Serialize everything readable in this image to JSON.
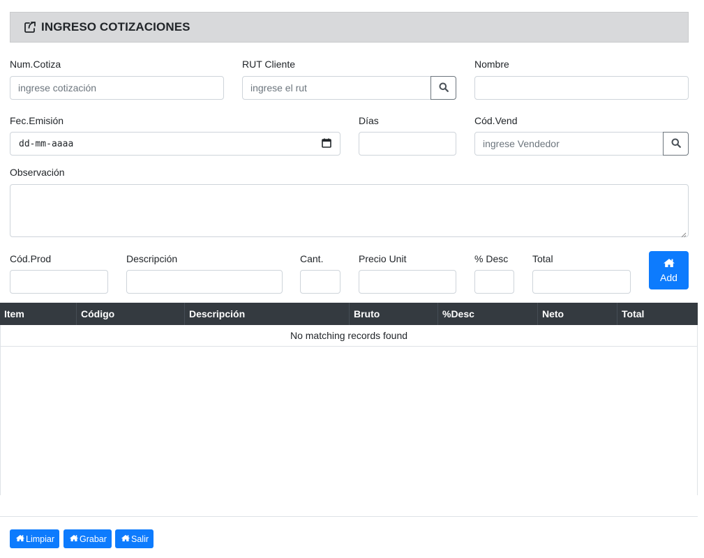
{
  "header": {
    "title": "INGRESO COTIZACIONES",
    "icon": "share-square-icon"
  },
  "form": {
    "num_cotiza": {
      "label": "Num.Cotiza",
      "placeholder": "ingrese cotización",
      "value": ""
    },
    "rut_cliente": {
      "label": "RUT Cliente",
      "placeholder": "ingrese el rut",
      "value": ""
    },
    "nombre": {
      "label": "Nombre",
      "placeholder": "",
      "value": ""
    },
    "fec_emision": {
      "label": "Fec.Emisión",
      "placeholder": "dd-mm-aaaa"
    },
    "dias": {
      "label": "Días",
      "value": ""
    },
    "cod_vend": {
      "label": "Cód.Vend",
      "placeholder": "ingrese Vendedor",
      "value": ""
    },
    "observacion": {
      "label": "Observación",
      "value": ""
    }
  },
  "product_line": {
    "cod_prod_label": "Cód.Prod",
    "descripcion_label": "Descripción",
    "cant_label": "Cant.",
    "precio_unit_label": "Precio Unit",
    "desc_label": "% Desc",
    "total_label": "Total",
    "add_button_label": "Add"
  },
  "table": {
    "columns": [
      "Item",
      "Código",
      "Descripción",
      "Bruto",
      "%Desc",
      "Neto",
      "Total"
    ],
    "empty_message": "No matching records found"
  },
  "footer": {
    "limpiar_label": "Limpiar",
    "grabar_label": "Grabar",
    "salir_label": "Salir"
  },
  "colors": {
    "primary": "#0d7bfd",
    "header_bg": "#d8d9db",
    "table_header_bg": "#343a40"
  }
}
